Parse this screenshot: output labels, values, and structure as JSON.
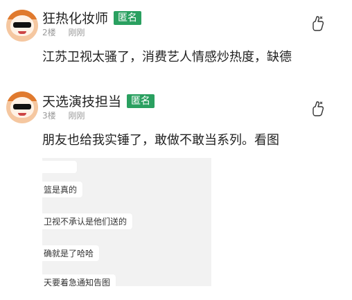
{
  "comments": [
    {
      "username": "狂热化妆师",
      "badge": "匿名",
      "floor": "2楼",
      "time": "刚刚",
      "text": "江苏卫视太骚了，消费艺人情感炒热度，缺德"
    },
    {
      "username": "天选演技担当",
      "badge": "匿名",
      "floor": "3楼",
      "time": "刚刚",
      "text": "朋友也给我实锤了，敢做不敢当系列。看图",
      "image_messages": [
        "",
        "篮是真的",
        "卫视不承认是他们送的",
        "确就是了哈哈",
        "天要着急通知告图"
      ]
    }
  ],
  "colors": {
    "badge_bg": "#2aa060",
    "meta_text": "#999999",
    "body_text": "#222222"
  },
  "icons": {
    "like": "hand-heart-icon"
  }
}
